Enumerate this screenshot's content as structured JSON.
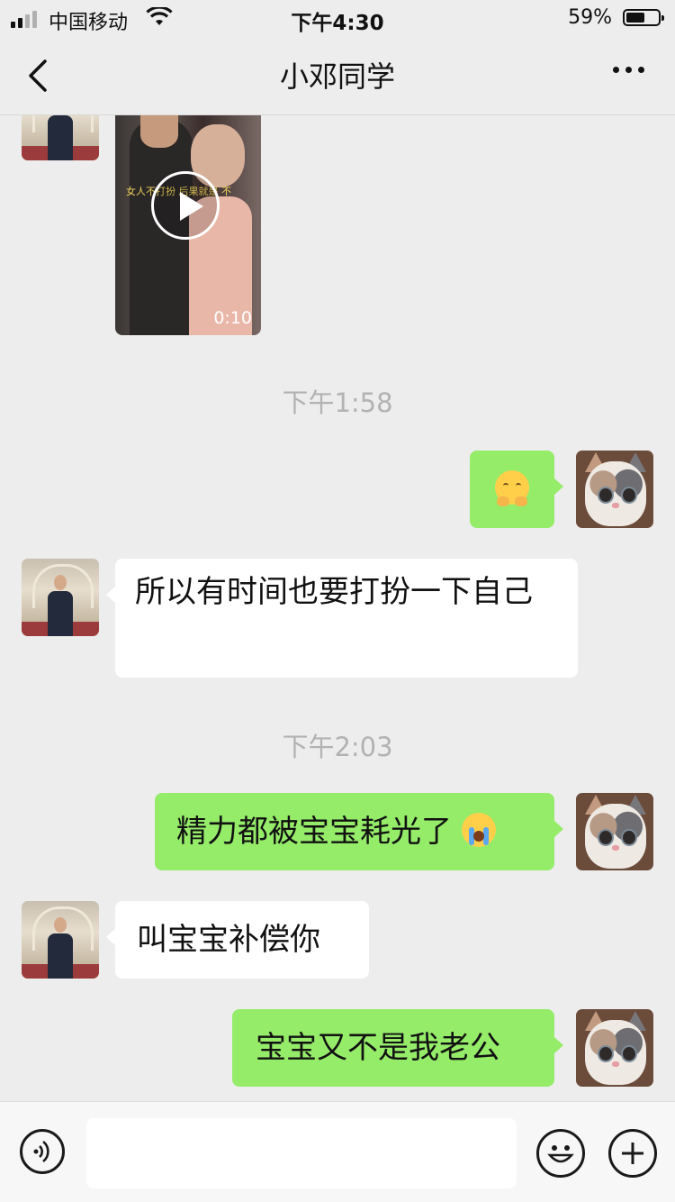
{
  "status_bar": {
    "carrier": "中国移动",
    "time": "下午4:30",
    "battery_pct": "59%",
    "battery_level": 0.59
  },
  "nav": {
    "title": "小邓同学"
  },
  "messages": {
    "video": {
      "duration": "0:10",
      "caption": "女人不打扮 后果就是 不"
    },
    "ts1": "下午1:58",
    "m1_emoji": "pouting-hug-emoji",
    "m2": "所以有时间也要打扮一下自己",
    "ts2": "下午2:03",
    "m3": "精力都被宝宝耗光了",
    "m3_emoji": "loudly-crying-emoji",
    "m4": "叫宝宝补偿你",
    "m5": "宝宝又不是我老公"
  },
  "input": {
    "value": ""
  },
  "icons": {
    "voice": "voice-icon",
    "emoji": "emoji-icon",
    "plus": "plus-icon"
  }
}
